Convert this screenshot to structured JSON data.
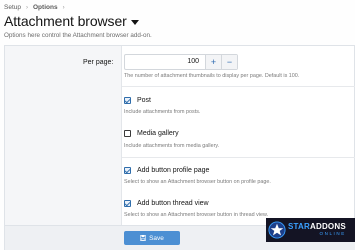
{
  "breadcrumb": {
    "items": [
      "Setup",
      "Options"
    ],
    "separator": "›"
  },
  "page": {
    "title": "Attachment browser",
    "subtitle": "Options here control the Attachment browser add-on."
  },
  "per_page": {
    "label": "Per page:",
    "value": "100",
    "increment": "+",
    "decrement": "−",
    "hint": "The number of attachment thumbnails to display per page. Default is 100."
  },
  "options": [
    {
      "label": "Post",
      "checked": true,
      "hint": "Include attachments from posts."
    },
    {
      "label": "Media gallery",
      "checked": false,
      "hint": "Include attachments from media gallery."
    },
    {
      "label": "Add button profile page",
      "checked": true,
      "hint": "Select to show an Attachment browser button on profile page."
    },
    {
      "label": "Add button thread view",
      "checked": true,
      "hint": "Select to show an Attachment browser button in thread view."
    }
  ],
  "footer": {
    "save_label": "Save"
  },
  "watermark": {
    "line1_a": "STAR",
    "line1_b": "ADDONS",
    "line2": "ONLINE"
  },
  "colors": {
    "accent": "#4c8fd3",
    "checkbox": "#2f6dab",
    "badge_bg": "#141424",
    "badge_blue": "#3aa0ff"
  },
  "icons": {
    "caret": "caret-down-icon",
    "save": "save-icon",
    "logo": "star-icon"
  }
}
